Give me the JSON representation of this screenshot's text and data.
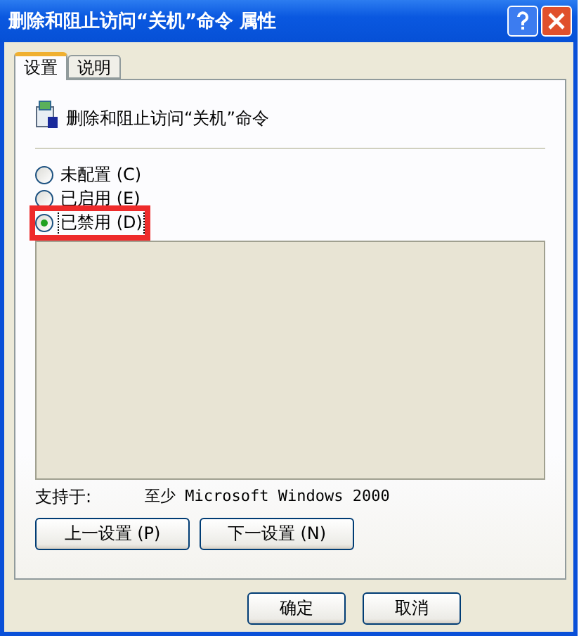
{
  "window": {
    "title": "删除和阻止访问“关机”命令 属性"
  },
  "tabs": [
    {
      "label": "设置",
      "selected": true
    },
    {
      "label": "说明",
      "selected": false
    }
  ],
  "setting": {
    "name": "删除和阻止访问“关机”命令"
  },
  "options": [
    {
      "label": "未配置 (C)",
      "selected": false
    },
    {
      "label": "已启用 (E)",
      "selected": false
    },
    {
      "label": "已禁用 (D)",
      "selected": true,
      "highlighted": true
    }
  ],
  "supported": {
    "label": "支持于:",
    "value": "至少 Microsoft Windows 2000"
  },
  "nav_buttons": [
    "上一设置 (P)",
    "下一设置 (N)"
  ],
  "buttons": [
    "确定",
    "取消"
  ]
}
